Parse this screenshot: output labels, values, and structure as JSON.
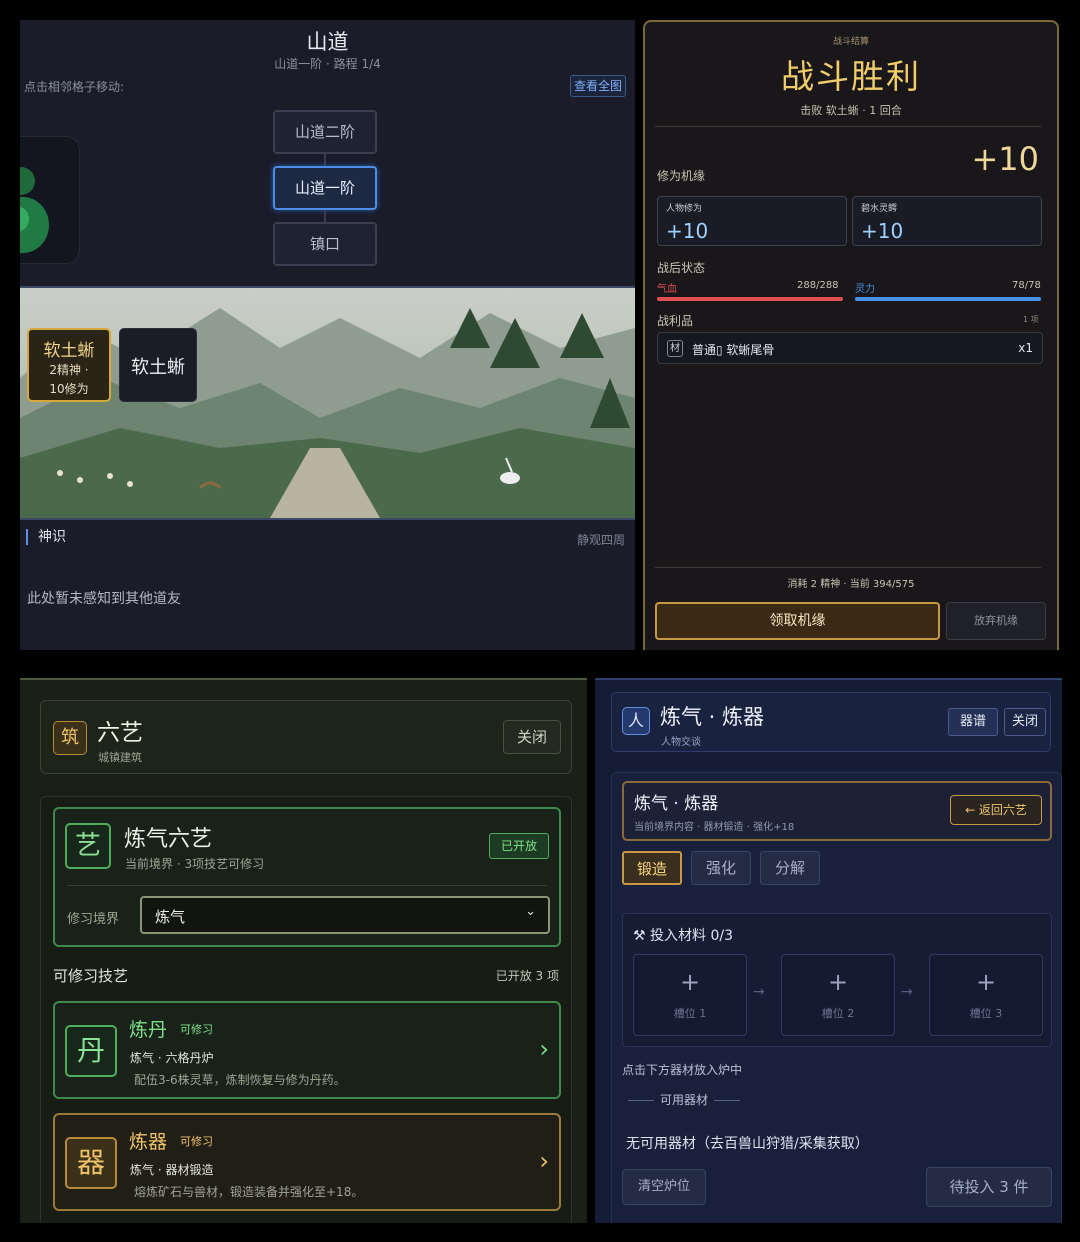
{
  "map": {
    "title": "山道",
    "subtitle": "山道一阶 · 路程 1/4",
    "hint": "点击相邻格子移动:",
    "view_all": "查看全图",
    "nodes": [
      "山道二阶",
      "山道一阶",
      "镇口"
    ],
    "current_node": "山道一阶",
    "enemies": [
      {
        "name": "软土蜥",
        "stats": [
          "2精神 ·",
          "10修为"
        ],
        "selected": true
      },
      {
        "name": "软土蜥",
        "selected": false
      }
    ],
    "sense": {
      "title": "神识",
      "action": "静观四周",
      "message": "此处暂未感知到其他道友"
    }
  },
  "battle": {
    "tag": "战斗结算",
    "title": "战斗胜利",
    "desc": "击败 软土蜥 · 1 回合",
    "fortune_label": "修为机缘",
    "fortune_value": "+10",
    "gains": [
      {
        "label": "人物修为",
        "value": "+10"
      },
      {
        "label": "碧水灵鳄",
        "value": "+10"
      }
    ],
    "post_label": "战后状态",
    "hp_label": "气血",
    "hp_value": "288/288",
    "hp_fraction": 1.0,
    "hp_color": "#e05050",
    "mp_label": "灵力",
    "mp_value": "78/78",
    "mp_fraction": 1.0,
    "mp_color": "#4a90e8",
    "loot_label": "战利品",
    "loot_count": "1 项",
    "loot": {
      "tag": "材",
      "name": "普通▯ 软蜥尾骨",
      "qty": "x1"
    },
    "cost": "消耗 2 精神 · 当前 394/575",
    "claim_button": "领取机缘",
    "abandon_button": "放弃机缘"
  },
  "arts": {
    "glyph": "筑",
    "title": "六艺",
    "subtitle": "城镇建筑",
    "close": "关闭",
    "main": {
      "glyph": "艺",
      "title": "炼气六艺",
      "subtitle": "当前境界 · 3项技艺可修习",
      "badge": "已开放",
      "realm_label": "修习境界",
      "realm_value": "炼气"
    },
    "list_title": "可修习技艺",
    "list_count": "已开放 3 项",
    "skills": [
      {
        "glyph": "丹",
        "name": "炼丹",
        "status": "可修习",
        "line2": "炼气 · 六格丹炉",
        "line3": "配伍3-6株灵草，炼制恢复与修为丹药。",
        "style": "green"
      },
      {
        "glyph": "器",
        "name": "炼器",
        "status": "可修习",
        "line2": "炼气 · 器材锻造",
        "line3": "熔炼矿石与兽材，锻造装备并强化至+18。",
        "style": "gold"
      }
    ]
  },
  "forge": {
    "glyph": "人",
    "title": "炼气 · 炼器",
    "subtitle": "人物交谈",
    "recipe_button": "器谱",
    "close_button": "关闭",
    "section_title": "炼气 · 炼器",
    "section_sub": "当前境界内容 · 器材锻造 · 强化+18",
    "back_button": "← 返回六艺",
    "tabs": [
      "锻造",
      "强化",
      "分解"
    ],
    "active_tab": "锻造",
    "materials_title": "⚒ 投入材料  0/3",
    "slots": [
      "槽位 1",
      "槽位 2",
      "槽位 3"
    ],
    "slot_plus": "+",
    "slot_arrow": "→",
    "hint": "点击下方器材放入炉中",
    "available_label": "可用器材",
    "none_text": "无可用器材（去百兽山狩猎/采集获取）",
    "clear_button": "清空炉位",
    "pending_button": "待投入 3 件"
  }
}
